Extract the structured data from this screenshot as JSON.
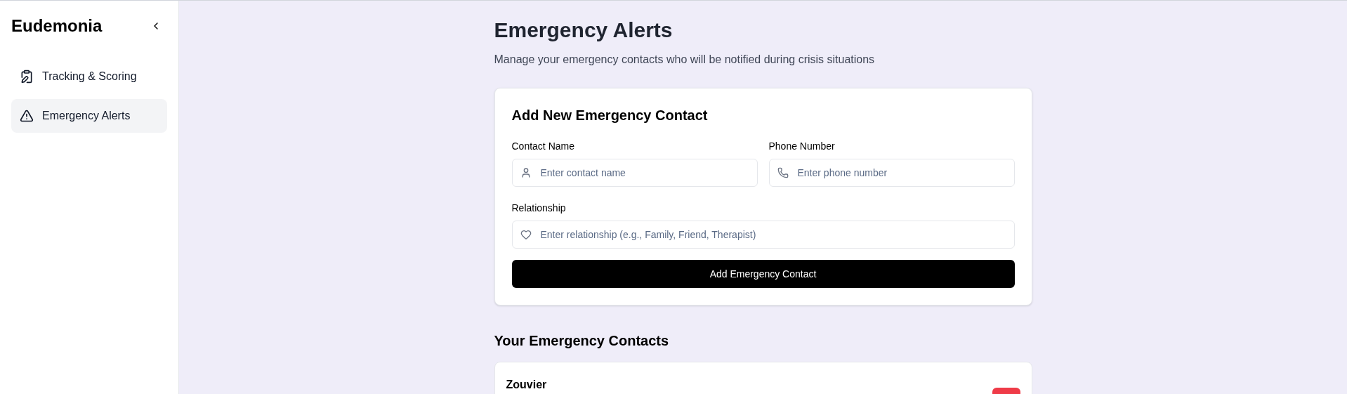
{
  "sidebar": {
    "title": "Eudemonia",
    "items": [
      {
        "label": "Tracking & Scoring",
        "kind": "clipboard",
        "selected": false
      },
      {
        "label": "Emergency Alerts",
        "kind": "alert",
        "selected": true
      }
    ]
  },
  "page": {
    "title": "Emergency Alerts",
    "subtitle": "Manage your emergency contacts who will be notified during crisis situations"
  },
  "form": {
    "title": "Add New Emergency Contact",
    "fields": [
      {
        "label": "Contact Name",
        "placeholder": "Enter contact name",
        "kind": "person"
      },
      {
        "label": "Phone Number",
        "placeholder": "Enter phone number",
        "kind": "phone"
      },
      {
        "label": "Relationship",
        "placeholder": "Enter relationship (e.g., Family, Friend, Therapist)",
        "kind": "heart"
      }
    ],
    "button": "Add Emergency Contact"
  },
  "contacts": {
    "title": "Your Emergency Contacts",
    "items": [
      {
        "name": "Zouvier"
      }
    ]
  }
}
